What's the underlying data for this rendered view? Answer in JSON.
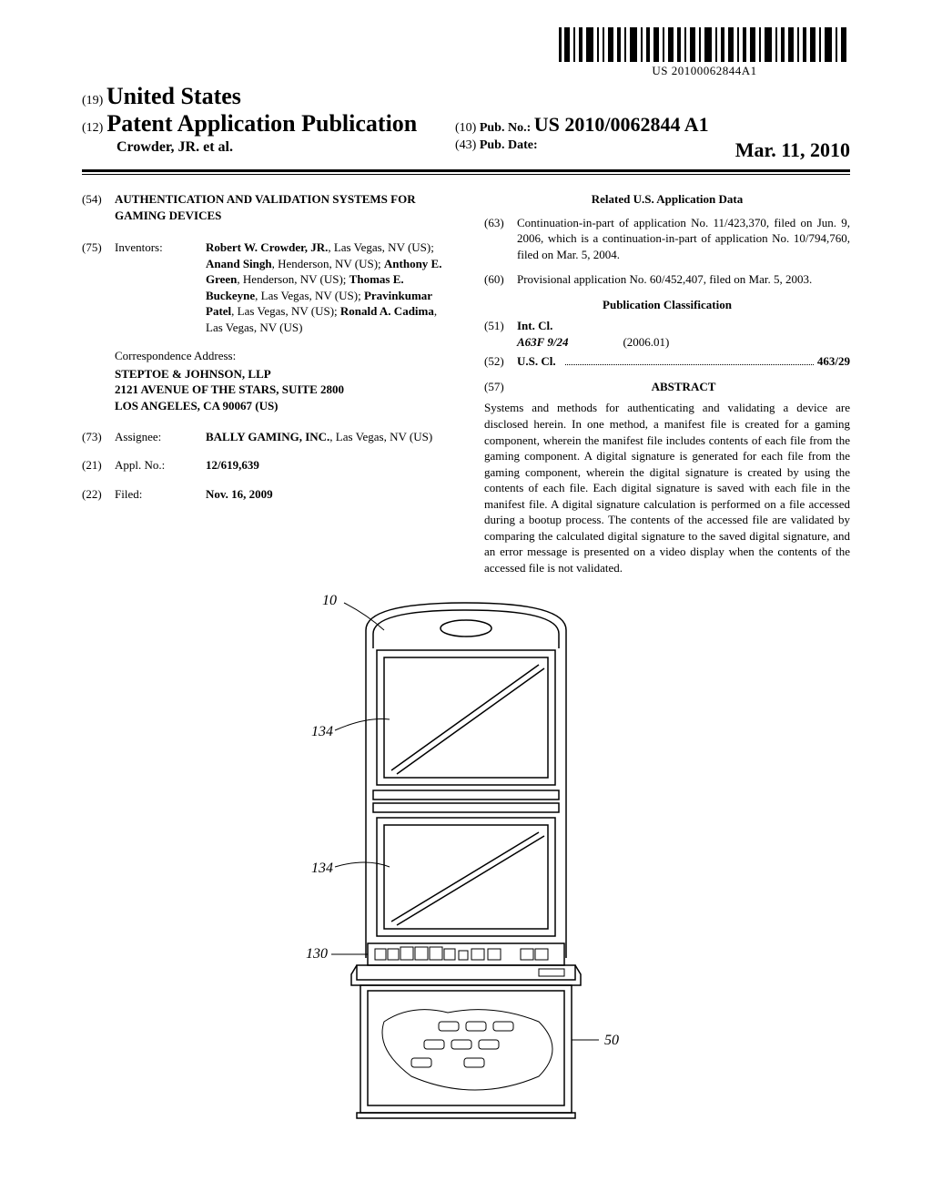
{
  "barcode_text": "US 20100062844A1",
  "header": {
    "country_num": "(19)",
    "country": "United States",
    "pub_num_label": "(12)",
    "pub_title": "Patent Application Publication",
    "author_line": "Crowder, JR. et al.",
    "pubno_num": "(10)",
    "pubno_label": "Pub. No.:",
    "pubno_value": "US 2010/0062844 A1",
    "pubdate_num": "(43)",
    "pubdate_label": "Pub. Date:",
    "pubdate_value": "Mar. 11, 2010"
  },
  "title_block": {
    "num": "(54)",
    "text": "AUTHENTICATION AND VALIDATION SYSTEMS FOR GAMING DEVICES"
  },
  "inventors": {
    "num": "(75)",
    "label": "Inventors:",
    "names_html": "<b>Robert W. Crowder, JR.</b>, Las Vegas, NV (US); <b>Anand Singh</b>, Henderson, NV (US); <b>Anthony E. Green</b>, Henderson, NV (US); <b>Thomas E. Buckeyne</b>, Las Vegas, NV (US); <b>Pravinkumar Patel</b>, Las Vegas, NV (US); <b>Ronald A. Cadima</b>, Las Vegas, NV (US)"
  },
  "correspondence": {
    "label": "Correspondence Address:",
    "lines": [
      "STEPTOE & JOHNSON, LLP",
      "2121 AVENUE OF THE STARS, SUITE 2800",
      "LOS ANGELES, CA 90067 (US)"
    ]
  },
  "assignee": {
    "num": "(73)",
    "label": "Assignee:",
    "value_html": "<b>BALLY GAMING, INC.</b>, Las Vegas, NV (US)"
  },
  "applno": {
    "num": "(21)",
    "label": "Appl. No.:",
    "value": "12/619,639"
  },
  "filed": {
    "num": "(22)",
    "label": "Filed:",
    "value": "Nov. 16, 2009"
  },
  "related_heading": "Related U.S. Application Data",
  "related63": {
    "num": "(63)",
    "text": "Continuation-in-part of application No. 11/423,370, filed on Jun. 9, 2006, which is a continuation-in-part of application No. 10/794,760, filed on Mar. 5, 2004."
  },
  "related60": {
    "num": "(60)",
    "text": "Provisional application No. 60/452,407, filed on Mar. 5, 2003."
  },
  "pubclass_heading": "Publication Classification",
  "intcl": {
    "num": "(51)",
    "label": "Int. Cl.",
    "code": "A63F 9/24",
    "version": "(2006.01)"
  },
  "uscl": {
    "num": "(52)",
    "label": "U.S. Cl.",
    "value": "463/29"
  },
  "abstract": {
    "num": "(57)",
    "heading": "ABSTRACT",
    "text": "Systems and methods for authenticating and validating a device are disclosed herein. In one method, a manifest file is created for a gaming component, wherein the manifest file includes contents of each file from the gaming component. A digital signature is generated for each file from the gaming component, wherein the digital signature is created by using the contents of each file. Each digital signature is saved with each file in the manifest file. A digital signature calculation is performed on a file accessed during a bootup process. The contents of the accessed file are validated by comparing the calculated digital signature to the saved digital signature, and an error message is presented on a video display when the contents of the accessed file is not validated."
  },
  "figure_labels": {
    "l10": "10",
    "l134a": "134",
    "l134b": "134",
    "l130": "130",
    "l50": "50"
  }
}
